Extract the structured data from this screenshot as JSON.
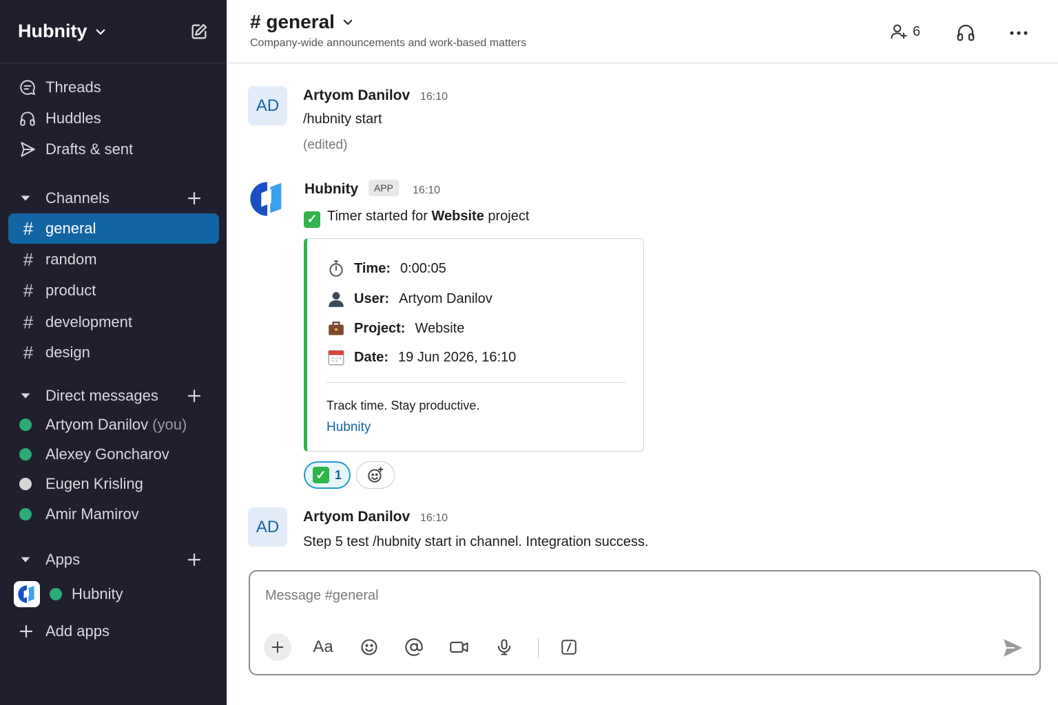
{
  "workspace": {
    "name": "Hubnity"
  },
  "nav": [
    {
      "label": "Threads",
      "icon": "threads-icon"
    },
    {
      "label": "Huddles",
      "icon": "headphones-icon"
    },
    {
      "label": "Drafts & sent",
      "icon": "send-icon"
    }
  ],
  "channels": {
    "title": "Channels",
    "items": [
      {
        "name": "general",
        "active": true
      },
      {
        "name": "random"
      },
      {
        "name": "product"
      },
      {
        "name": "development"
      },
      {
        "name": "design"
      }
    ]
  },
  "direct_messages": {
    "title": "Direct messages",
    "items": [
      {
        "name": "Artyom Danilov",
        "suffix": "(you)",
        "status": "online"
      },
      {
        "name": "Alexey Goncharov",
        "status": "online"
      },
      {
        "name": "Eugen Krisling",
        "status": "away"
      },
      {
        "name": "Amir Mamirov",
        "status": "online"
      }
    ]
  },
  "apps": {
    "title": "Apps",
    "items": [
      {
        "name": "Hubnity",
        "status": "online"
      }
    ],
    "add_label": "Add apps"
  },
  "channel_header": {
    "title": "# general",
    "description": "Company-wide announcements and work-based matters",
    "member_count": "6"
  },
  "messages": [
    {
      "author": "Artyom Danilov",
      "initials": "AD",
      "time": "16:10",
      "text": "/hubnity start",
      "edited": "(edited)"
    },
    {
      "author": "Hubnity",
      "badge": "APP",
      "time": "16:10",
      "text_pre": "Timer started for ",
      "text_bold": "Website",
      "text_post": " project",
      "card": {
        "rows": [
          {
            "label": "Time:",
            "value": "0:00:05",
            "icon": "stopwatch-icon"
          },
          {
            "label": "User:",
            "value": "Artyom Danilov",
            "icon": "user-icon"
          },
          {
            "label": "Project:",
            "value": "Website",
            "icon": "briefcase-icon"
          },
          {
            "label": "Date:",
            "value": "19 Jun 2026, 16:10",
            "icon": "calendar-icon"
          }
        ],
        "footer": "Track time. Stay productive.",
        "link": "Hubnity"
      },
      "reaction_count": "1"
    },
    {
      "author": "Artyom Danilov",
      "initials": "AD",
      "time": "16:10",
      "text": "Step 5 test /hubnity start in channel. Integration success."
    }
  ],
  "composer": {
    "placeholder": "Message #general",
    "format_label": "Aa"
  },
  "colors": {
    "sidebar_bg": "#1f1f2e",
    "active_channel": "#1264a3",
    "online": "#2bac76",
    "away": "#d6d6d6",
    "accent_green": "#2fb54a",
    "link": "#1264a3"
  }
}
